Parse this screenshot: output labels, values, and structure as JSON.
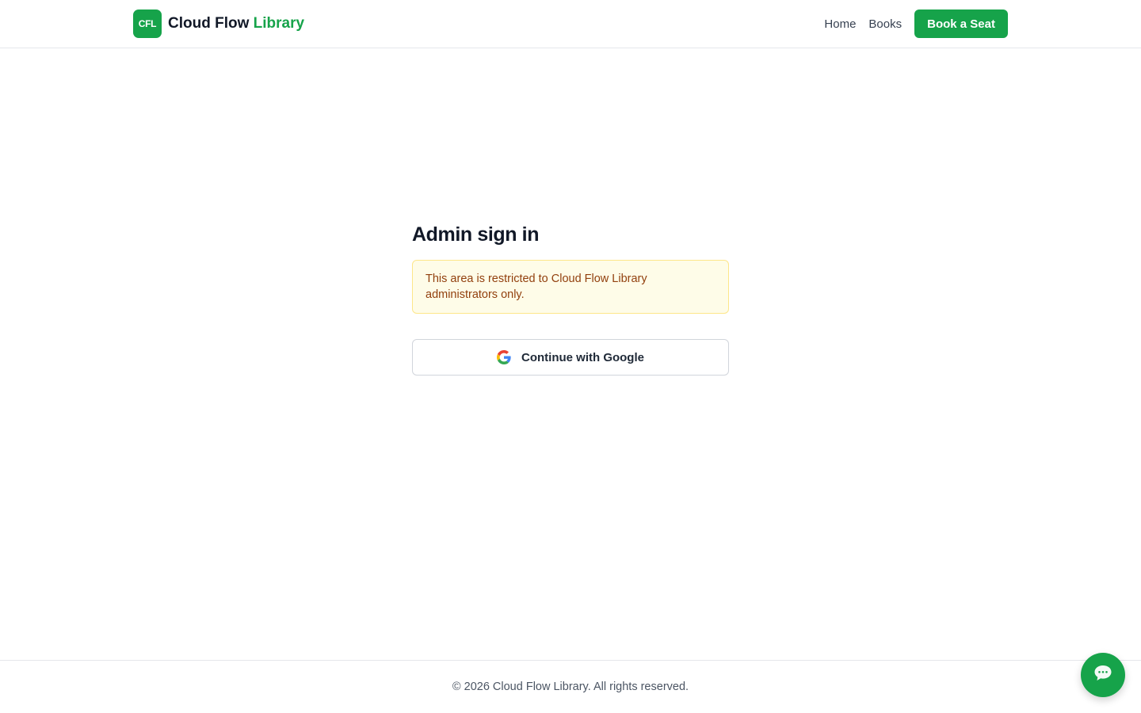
{
  "header": {
    "logo_text": "CFL",
    "brand_primary": "Cloud Flow",
    "brand_accent": "Library",
    "nav": [
      {
        "label": "Home"
      },
      {
        "label": "Books"
      }
    ],
    "cta_label": "Book a Seat"
  },
  "main": {
    "title": "Admin sign in",
    "notice": "This area is restricted to Cloud Flow Library administrators only.",
    "google_button_label": "Continue with Google",
    "google_icon": "google-icon"
  },
  "footer": {
    "copyright": "© 2026 Cloud Flow Library. All rights reserved."
  },
  "chat": {
    "icon": "chat-bubble-icon"
  },
  "colors": {
    "brand_green": "#16a34a",
    "notice_bg": "#fefce8",
    "notice_border": "#fde68a",
    "notice_text": "#92400e"
  }
}
